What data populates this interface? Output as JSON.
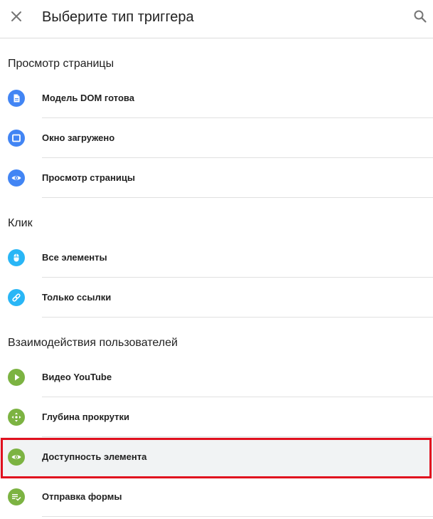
{
  "header": {
    "title": "Выберите тип триггера",
    "close_icon": "close-icon",
    "search_icon": "search-icon"
  },
  "sections": [
    {
      "title": "Просмотр страницы",
      "items": [
        {
          "label": "Модель DOM готова",
          "icon": "document-icon",
          "color": "#4285f4"
        },
        {
          "label": "Окно загружено",
          "icon": "window-icon",
          "color": "#4285f4"
        },
        {
          "label": "Просмотр страницы",
          "icon": "eye-icon",
          "color": "#4285f4"
        }
      ]
    },
    {
      "title": "Клик",
      "items": [
        {
          "label": "Все элементы",
          "icon": "mouse-icon",
          "color": "#29b6f6"
        },
        {
          "label": "Только ссылки",
          "icon": "link-icon",
          "color": "#29b6f6"
        }
      ]
    },
    {
      "title": "Взаимодействия пользователей",
      "items": [
        {
          "label": "Видео YouTube",
          "icon": "play-icon",
          "color": "#7cb342"
        },
        {
          "label": "Глубина прокрутки",
          "icon": "scroll-arrows-icon",
          "color": "#7cb342"
        },
        {
          "label": "Доступность элемента",
          "icon": "eye-icon",
          "color": "#7cb342",
          "selected": true
        },
        {
          "label": "Отправка формы",
          "icon": "form-check-icon",
          "color": "#7cb342"
        }
      ]
    }
  ],
  "colors": {
    "highlight_border": "#e0101e",
    "selected_background": "#f1f3f4"
  }
}
